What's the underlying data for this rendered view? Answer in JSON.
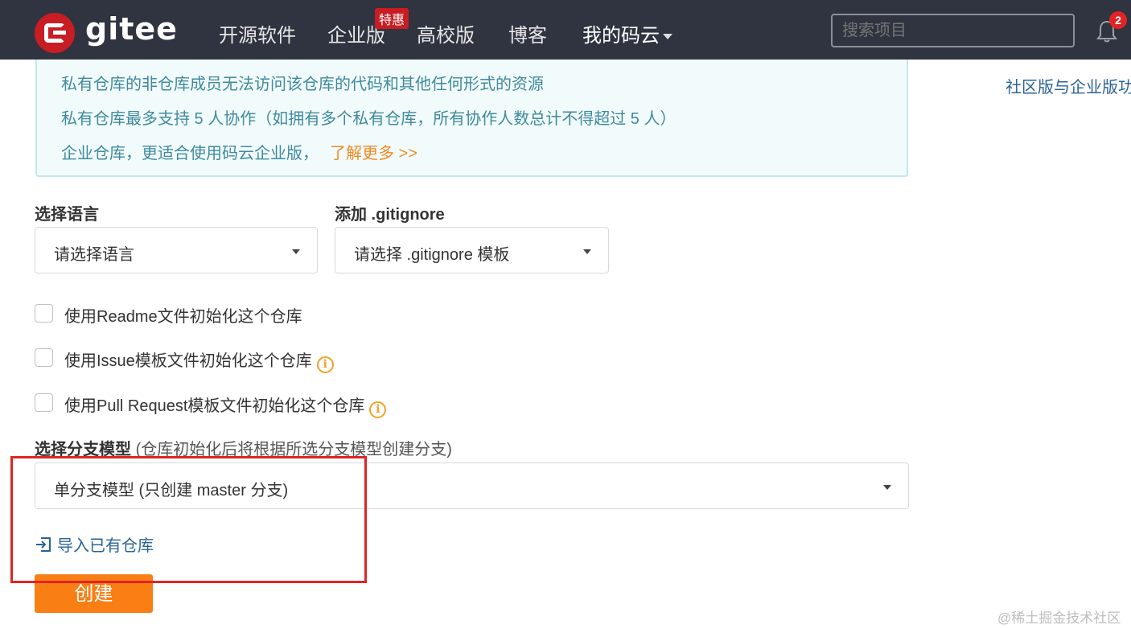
{
  "nav": {
    "logo_text": "gitee",
    "items": [
      {
        "label": "开源软件"
      },
      {
        "label": "企业版"
      },
      {
        "label": "高校版"
      },
      {
        "label": "博客"
      },
      {
        "label": "我的码云"
      }
    ],
    "promo_badge": "特惠",
    "search_placeholder": "搜索项目",
    "notification_count": "2"
  },
  "info_box": {
    "lines": [
      "私有仓库的非仓库成员无法访问该仓库的代码和其他任何形式的资源",
      "私有仓库最多支持 5 人协作（如拥有多个私有仓库，所有协作人数总计不得超过 5 人）",
      "企业仓库，更适合使用码云企业版，"
    ],
    "learn_more": "了解更多 >>"
  },
  "side_link": "社区版与企业版功",
  "language": {
    "label": "选择语言",
    "value": "请选择语言"
  },
  "gitignore": {
    "label": "添加 .gitignore",
    "value": "请选择 .gitignore 模板"
  },
  "checkboxes": [
    {
      "label": "使用Readme文件初始化这个仓库",
      "checked": false,
      "has_info": false
    },
    {
      "label": "使用Issue模板文件初始化这个仓库",
      "checked": false,
      "has_info": true
    },
    {
      "label": "使用Pull Request模板文件初始化这个仓库",
      "checked": false,
      "has_info": true
    }
  ],
  "branch_model": {
    "label": "选择分支模型",
    "hint": "(仓库初始化后将根据所选分支模型创建分支)",
    "value": "单分支模型 (只创建 master 分支)"
  },
  "import_link": "导入已有仓库",
  "create_button": "创建",
  "watermark": "@稀土掘金技术社区",
  "colors": {
    "nav_bg": "#2f3440",
    "brand_red": "#c71d23",
    "create_orange": "#f97e13",
    "link_blue": "#2a6496",
    "info_text": "#3f8a9c",
    "annotation_red": "#e02424"
  }
}
